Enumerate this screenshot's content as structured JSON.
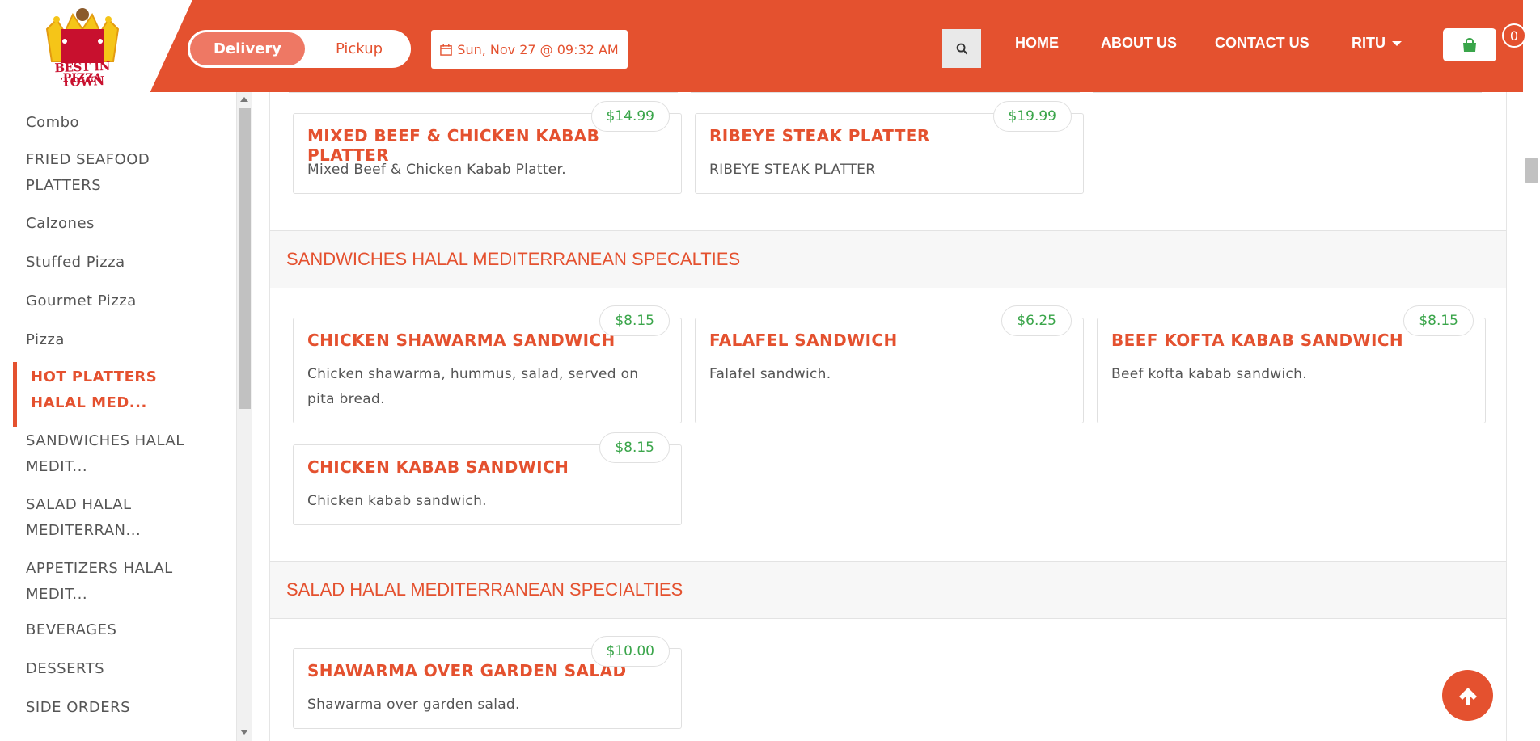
{
  "brand": {
    "logo_line1": "BEST IN TOWN",
    "logo_line2": "PIZZA"
  },
  "header": {
    "order_type": {
      "delivery_label": "Delivery",
      "pickup_label": "Pickup",
      "selected": "Delivery"
    },
    "datetime": "Sun, Nov 27 @ 09:32 AM",
    "nav": [
      {
        "label": "HOME"
      },
      {
        "label": "ABOUT US"
      },
      {
        "label": "CONTACT US"
      },
      {
        "label": "RITU"
      }
    ],
    "cart_count": "0"
  },
  "sidebar": {
    "items": [
      {
        "label": "Combo"
      },
      {
        "label": "FRIED SEAFOOD PLATTERS"
      },
      {
        "label": "Calzones"
      },
      {
        "label": "Stuffed Pizza"
      },
      {
        "label": "Gourmet Pizza"
      },
      {
        "label": "Pizza"
      },
      {
        "label": "HOT PLATTERS HALAL MED...",
        "active": true
      },
      {
        "label": "SANDWICHES HALAL MEDIT..."
      },
      {
        "label": "SALAD HALAL MEDITERRAN..."
      },
      {
        "label": "APPETIZERS HALAL MEDIT..."
      },
      {
        "label": "BEVERAGES"
      },
      {
        "label": "DESSERTS"
      },
      {
        "label": "SIDE ORDERS"
      }
    ]
  },
  "menu": {
    "hot_platters_items": [
      {
        "name": "MIXED BEEF & CHICKEN KABAB PLATTER",
        "description": "Mixed Beef & Chicken Kabab Platter.",
        "price": "$14.99"
      },
      {
        "name": "RIBEYE STEAK PLATTER",
        "description": "RIBEYE STEAK PLATTER",
        "price": "$19.99"
      }
    ],
    "sandwiches": {
      "title": "SANDWICHES HALAL MEDITERRANEAN SPECALTIES",
      "items": [
        {
          "name": "CHICKEN SHAWARMA SANDWICH",
          "description": "Chicken shawarma, hummus, salad, served on pita bread.",
          "price": "$8.15"
        },
        {
          "name": "FALAFEL SANDWICH",
          "description": "Falafel sandwich.",
          "price": "$6.25"
        },
        {
          "name": "BEEF KOFTA KABAB SANDWICH",
          "description": "Beef kofta kabab sandwich.",
          "price": "$8.15"
        },
        {
          "name": "CHICKEN KABAB SANDWICH",
          "description": "Chicken kabab sandwich.",
          "price": "$8.15"
        }
      ]
    },
    "salads": {
      "title": "SALAD HALAL MEDITERRANEAN SPECIALTIES",
      "items": [
        {
          "name": "SHAWARMA OVER GARDEN SALAD",
          "description": "Shawarma over garden salad.",
          "price": "$10.00"
        }
      ]
    }
  },
  "colors": {
    "brand": "#e4512f",
    "price": "#3aa54a",
    "text": "#555555"
  },
  "icons": {
    "calendar": "calendar-icon",
    "search": "search-icon",
    "cart": "shopping-bag-icon",
    "scroll_top": "arrow-up-icon"
  }
}
